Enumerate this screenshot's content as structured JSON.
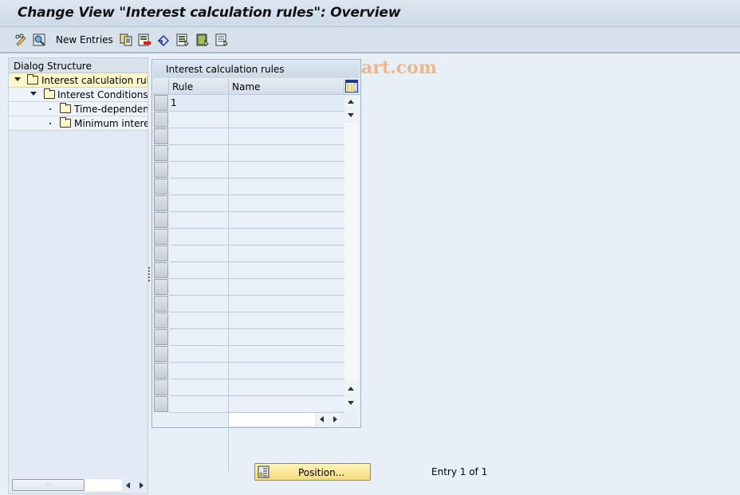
{
  "window": {
    "title": "Change View \"Interest calculation rules\": Overview"
  },
  "toolbar": {
    "items": [
      {
        "icon": "display-change-icon"
      },
      {
        "icon": "find-icon"
      },
      {
        "label": "New Entries"
      },
      {
        "icon": "copy-as-icon"
      },
      {
        "icon": "delete-icon"
      },
      {
        "icon": "undo-change-icon"
      },
      {
        "icon": "select-all-icon"
      },
      {
        "icon": "select-block-icon"
      },
      {
        "icon": "deselect-all-icon"
      }
    ],
    "new_entries_label": "New Entries"
  },
  "watermark": "www.tutorialkart.com",
  "dialog_structure": {
    "header": "Dialog Structure",
    "nodes": [
      {
        "label": "Interest calculation rules",
        "level": 0,
        "expanded": true,
        "selected": true
      },
      {
        "label": "Interest Conditions",
        "level": 1,
        "expanded": true,
        "selected": false
      },
      {
        "label": "Time-dependent",
        "level": 2,
        "expanded": false,
        "selected": false
      },
      {
        "label": "Minimum interest",
        "level": 2,
        "expanded": false,
        "selected": false
      }
    ]
  },
  "table": {
    "title": "Interest calculation rules",
    "columns": [
      "Rule",
      "Name"
    ],
    "rows": [
      {
        "rule": "1",
        "name": ""
      }
    ],
    "visible_row_count": 19
  },
  "footer": {
    "position_button": "Position...",
    "entry_info": "Entry 1 of 1"
  }
}
